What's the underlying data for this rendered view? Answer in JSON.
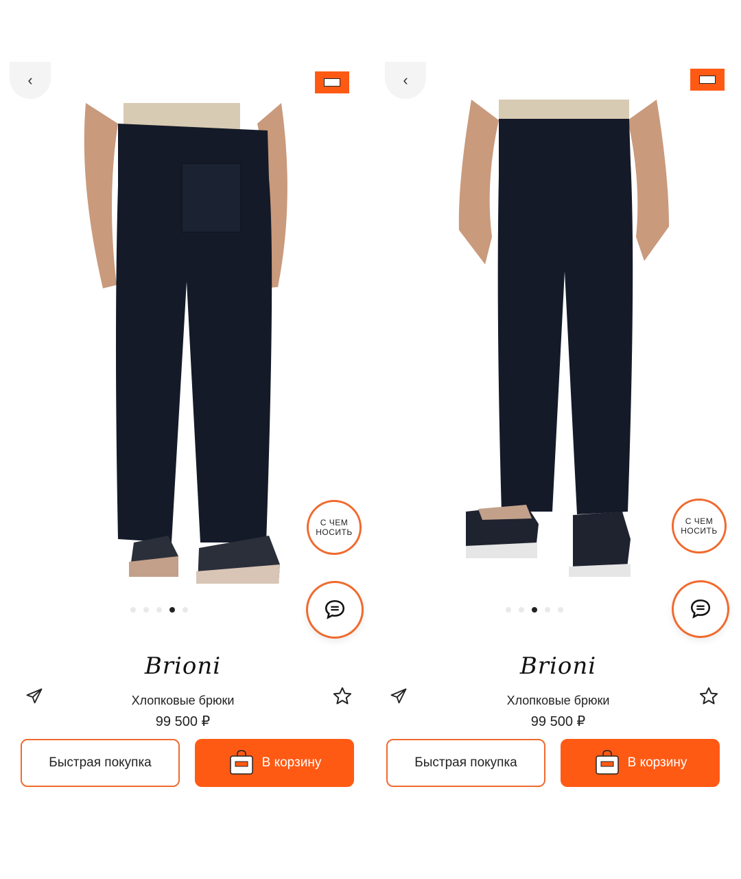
{
  "screens": [
    {
      "brand": "Brioni",
      "product_name": "Хлопковые брюки",
      "price": "99 500 ₽",
      "wear_button": "С ЧЕМ\nНОСИТЬ",
      "quick_buy_label": "Быстрая покупка",
      "add_to_cart_label": "В корзину",
      "carousel": {
        "total": 5,
        "active_index": 4
      }
    },
    {
      "brand": "Brioni",
      "product_name": "Хлопковые брюки",
      "price": "99 500 ₽",
      "wear_button": "С ЧЕМ\nНОСИТЬ",
      "quick_buy_label": "Быстрая покупка",
      "add_to_cart_label": "В корзину",
      "carousel": {
        "total": 5,
        "active_index": 3
      }
    }
  ],
  "colors": {
    "accent": "#ff5a14",
    "accent_border": "#f06a2e",
    "pants": "#141a28",
    "shirt": "#d8cbb3",
    "skin": "#c99a7c"
  },
  "icons": {
    "back": "chevron-left-icon",
    "badge": "shopping-bag-icon",
    "chat": "chat-bubble-icon",
    "share": "paper-plane-icon",
    "favorite": "star-icon",
    "cart": "shopping-bag-icon"
  }
}
